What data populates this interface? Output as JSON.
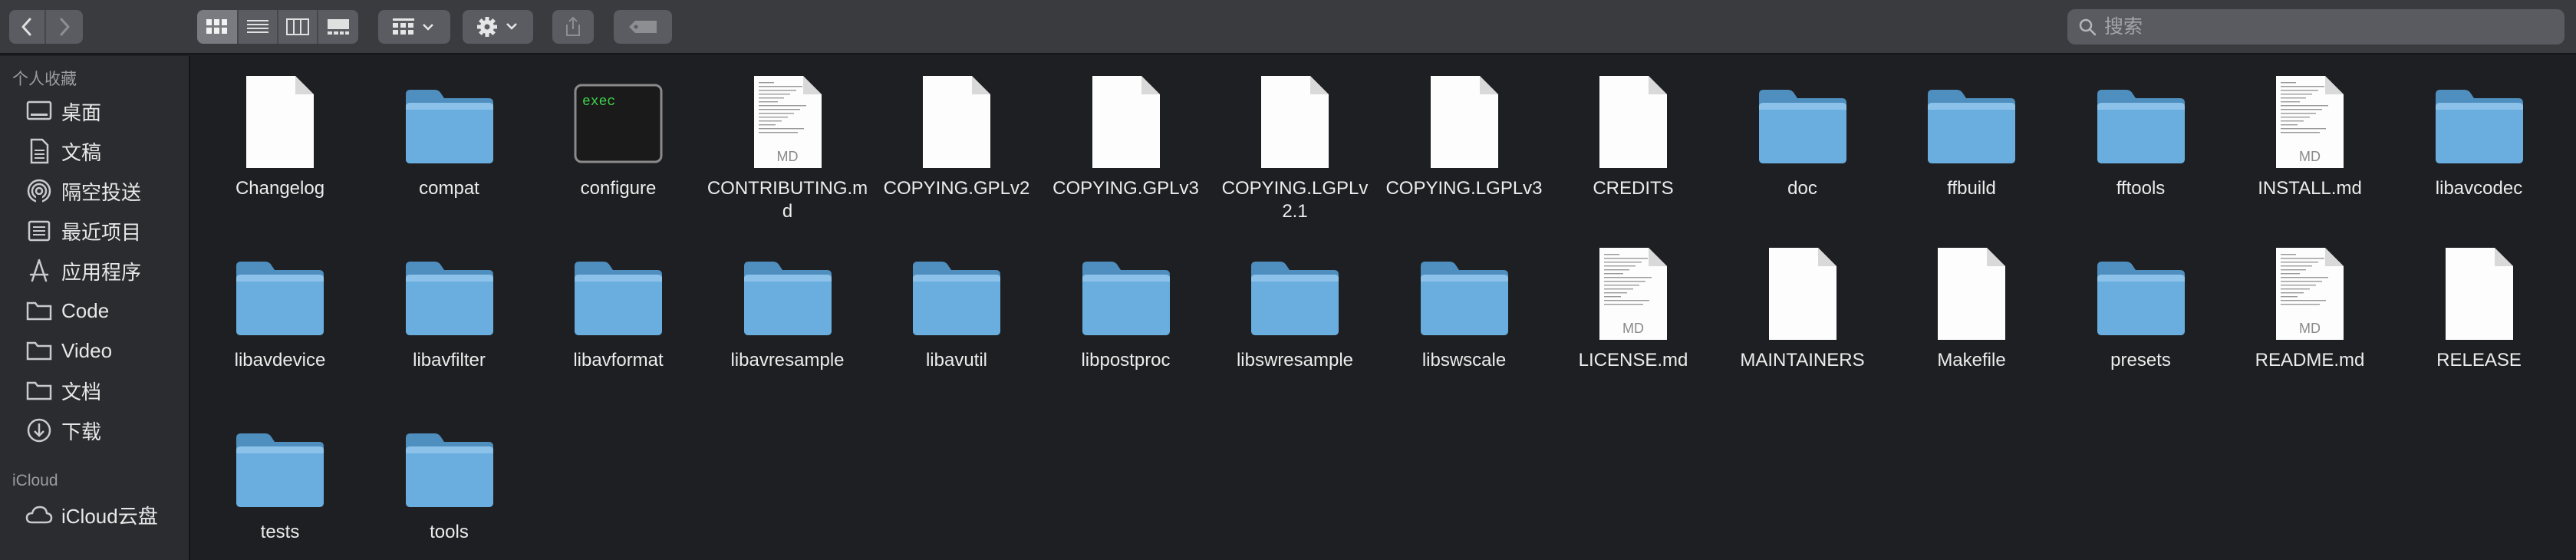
{
  "toolbar": {
    "nav": [
      "back-icon",
      "forward-icon"
    ],
    "view_modes": [
      "icon-view-icon",
      "list-view-icon",
      "column-view-icon",
      "gallery-view-icon"
    ],
    "group_button": "group-icon",
    "action_button": "gear-icon",
    "share_button": "share-icon",
    "tag_button": "tag-icon",
    "search_placeholder": "搜索"
  },
  "sidebar": {
    "favorites_title": "个人收藏",
    "items": [
      {
        "label": "桌面",
        "icon": "desktop-icon"
      },
      {
        "label": "文稿",
        "icon": "documents-icon"
      },
      {
        "label": "隔空投送",
        "icon": "airdrop-icon"
      },
      {
        "label": "最近项目",
        "icon": "recents-icon"
      },
      {
        "label": "应用程序",
        "icon": "applications-icon"
      },
      {
        "label": "Code",
        "icon": "folder-icon"
      },
      {
        "label": "Video",
        "icon": "folder-icon"
      },
      {
        "label": "文档",
        "icon": "folder-icon"
      },
      {
        "label": "下载",
        "icon": "downloads-icon"
      }
    ],
    "icloud_title": "iCloud",
    "icloud_items": [
      {
        "label": "iCloud云盘",
        "icon": "icloud-icon"
      }
    ]
  },
  "files": [
    {
      "name": "Changelog",
      "kind": "doc"
    },
    {
      "name": "compat",
      "kind": "folder"
    },
    {
      "name": "configure",
      "kind": "exec",
      "badge": "exec"
    },
    {
      "name": "CONTRIBUTING.md",
      "kind": "md",
      "badge": "MD"
    },
    {
      "name": "COPYING.GPLv2",
      "kind": "doc"
    },
    {
      "name": "COPYING.GPLv3",
      "kind": "doc"
    },
    {
      "name": "COPYING.LGPLv2.1",
      "kind": "doc"
    },
    {
      "name": "COPYING.LGPLv3",
      "kind": "doc"
    },
    {
      "name": "CREDITS",
      "kind": "doc"
    },
    {
      "name": "doc",
      "kind": "folder"
    },
    {
      "name": "ffbuild",
      "kind": "folder"
    },
    {
      "name": "fftools",
      "kind": "folder"
    },
    {
      "name": "INSTALL.md",
      "kind": "md",
      "badge": "MD"
    },
    {
      "name": "libavcodec",
      "kind": "folder"
    },
    {
      "name": "libavdevice",
      "kind": "folder"
    },
    {
      "name": "libavfilter",
      "kind": "folder"
    },
    {
      "name": "libavformat",
      "kind": "folder"
    },
    {
      "name": "libavresample",
      "kind": "folder"
    },
    {
      "name": "libavutil",
      "kind": "folder"
    },
    {
      "name": "libpostproc",
      "kind": "folder"
    },
    {
      "name": "libswresample",
      "kind": "folder"
    },
    {
      "name": "libswscale",
      "kind": "folder"
    },
    {
      "name": "LICENSE.md",
      "kind": "md",
      "badge": "MD"
    },
    {
      "name": "MAINTAINERS",
      "kind": "doc"
    },
    {
      "name": "Makefile",
      "kind": "doc"
    },
    {
      "name": "presets",
      "kind": "folder"
    },
    {
      "name": "README.md",
      "kind": "md",
      "badge": "MD"
    },
    {
      "name": "RELEASE",
      "kind": "doc"
    },
    {
      "name": "tests",
      "kind": "folder"
    },
    {
      "name": "tools",
      "kind": "folder"
    }
  ],
  "colors": {
    "folder": "#6aaedf",
    "folder_dark": "#4f8fbf",
    "background": "#1e1f22",
    "sidebar": "#2b2c30",
    "toolbar": "#3a3b3f"
  }
}
